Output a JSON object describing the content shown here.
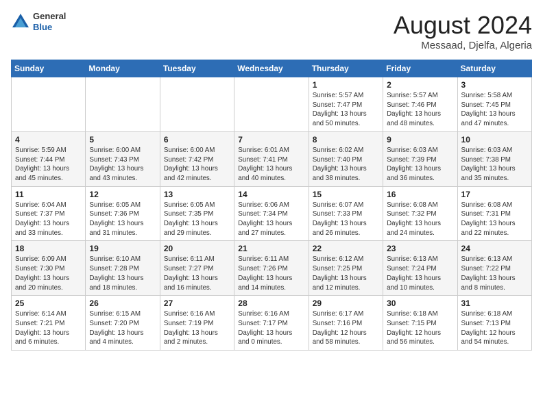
{
  "header": {
    "logo_general": "General",
    "logo_blue": "Blue",
    "title": "August 2024",
    "location": "Messaad, Djelfa, Algeria"
  },
  "weekdays": [
    "Sunday",
    "Monday",
    "Tuesday",
    "Wednesday",
    "Thursday",
    "Friday",
    "Saturday"
  ],
  "weeks": [
    [
      {
        "day": "",
        "info": ""
      },
      {
        "day": "",
        "info": ""
      },
      {
        "day": "",
        "info": ""
      },
      {
        "day": "",
        "info": ""
      },
      {
        "day": "1",
        "info": "Sunrise: 5:57 AM\nSunset: 7:47 PM\nDaylight: 13 hours\nand 50 minutes."
      },
      {
        "day": "2",
        "info": "Sunrise: 5:57 AM\nSunset: 7:46 PM\nDaylight: 13 hours\nand 48 minutes."
      },
      {
        "day": "3",
        "info": "Sunrise: 5:58 AM\nSunset: 7:45 PM\nDaylight: 13 hours\nand 47 minutes."
      }
    ],
    [
      {
        "day": "4",
        "info": "Sunrise: 5:59 AM\nSunset: 7:44 PM\nDaylight: 13 hours\nand 45 minutes."
      },
      {
        "day": "5",
        "info": "Sunrise: 6:00 AM\nSunset: 7:43 PM\nDaylight: 13 hours\nand 43 minutes."
      },
      {
        "day": "6",
        "info": "Sunrise: 6:00 AM\nSunset: 7:42 PM\nDaylight: 13 hours\nand 42 minutes."
      },
      {
        "day": "7",
        "info": "Sunrise: 6:01 AM\nSunset: 7:41 PM\nDaylight: 13 hours\nand 40 minutes."
      },
      {
        "day": "8",
        "info": "Sunrise: 6:02 AM\nSunset: 7:40 PM\nDaylight: 13 hours\nand 38 minutes."
      },
      {
        "day": "9",
        "info": "Sunrise: 6:03 AM\nSunset: 7:39 PM\nDaylight: 13 hours\nand 36 minutes."
      },
      {
        "day": "10",
        "info": "Sunrise: 6:03 AM\nSunset: 7:38 PM\nDaylight: 13 hours\nand 35 minutes."
      }
    ],
    [
      {
        "day": "11",
        "info": "Sunrise: 6:04 AM\nSunset: 7:37 PM\nDaylight: 13 hours\nand 33 minutes."
      },
      {
        "day": "12",
        "info": "Sunrise: 6:05 AM\nSunset: 7:36 PM\nDaylight: 13 hours\nand 31 minutes."
      },
      {
        "day": "13",
        "info": "Sunrise: 6:05 AM\nSunset: 7:35 PM\nDaylight: 13 hours\nand 29 minutes."
      },
      {
        "day": "14",
        "info": "Sunrise: 6:06 AM\nSunset: 7:34 PM\nDaylight: 13 hours\nand 27 minutes."
      },
      {
        "day": "15",
        "info": "Sunrise: 6:07 AM\nSunset: 7:33 PM\nDaylight: 13 hours\nand 26 minutes."
      },
      {
        "day": "16",
        "info": "Sunrise: 6:08 AM\nSunset: 7:32 PM\nDaylight: 13 hours\nand 24 minutes."
      },
      {
        "day": "17",
        "info": "Sunrise: 6:08 AM\nSunset: 7:31 PM\nDaylight: 13 hours\nand 22 minutes."
      }
    ],
    [
      {
        "day": "18",
        "info": "Sunrise: 6:09 AM\nSunset: 7:30 PM\nDaylight: 13 hours\nand 20 minutes."
      },
      {
        "day": "19",
        "info": "Sunrise: 6:10 AM\nSunset: 7:28 PM\nDaylight: 13 hours\nand 18 minutes."
      },
      {
        "day": "20",
        "info": "Sunrise: 6:11 AM\nSunset: 7:27 PM\nDaylight: 13 hours\nand 16 minutes."
      },
      {
        "day": "21",
        "info": "Sunrise: 6:11 AM\nSunset: 7:26 PM\nDaylight: 13 hours\nand 14 minutes."
      },
      {
        "day": "22",
        "info": "Sunrise: 6:12 AM\nSunset: 7:25 PM\nDaylight: 13 hours\nand 12 minutes."
      },
      {
        "day": "23",
        "info": "Sunrise: 6:13 AM\nSunset: 7:24 PM\nDaylight: 13 hours\nand 10 minutes."
      },
      {
        "day": "24",
        "info": "Sunrise: 6:13 AM\nSunset: 7:22 PM\nDaylight: 13 hours\nand 8 minutes."
      }
    ],
    [
      {
        "day": "25",
        "info": "Sunrise: 6:14 AM\nSunset: 7:21 PM\nDaylight: 13 hours\nand 6 minutes."
      },
      {
        "day": "26",
        "info": "Sunrise: 6:15 AM\nSunset: 7:20 PM\nDaylight: 13 hours\nand 4 minutes."
      },
      {
        "day": "27",
        "info": "Sunrise: 6:16 AM\nSunset: 7:19 PM\nDaylight: 13 hours\nand 2 minutes."
      },
      {
        "day": "28",
        "info": "Sunrise: 6:16 AM\nSunset: 7:17 PM\nDaylight: 13 hours\nand 0 minutes."
      },
      {
        "day": "29",
        "info": "Sunrise: 6:17 AM\nSunset: 7:16 PM\nDaylight: 12 hours\nand 58 minutes."
      },
      {
        "day": "30",
        "info": "Sunrise: 6:18 AM\nSunset: 7:15 PM\nDaylight: 12 hours\nand 56 minutes."
      },
      {
        "day": "31",
        "info": "Sunrise: 6:18 AM\nSunset: 7:13 PM\nDaylight: 12 hours\nand 54 minutes."
      }
    ]
  ]
}
